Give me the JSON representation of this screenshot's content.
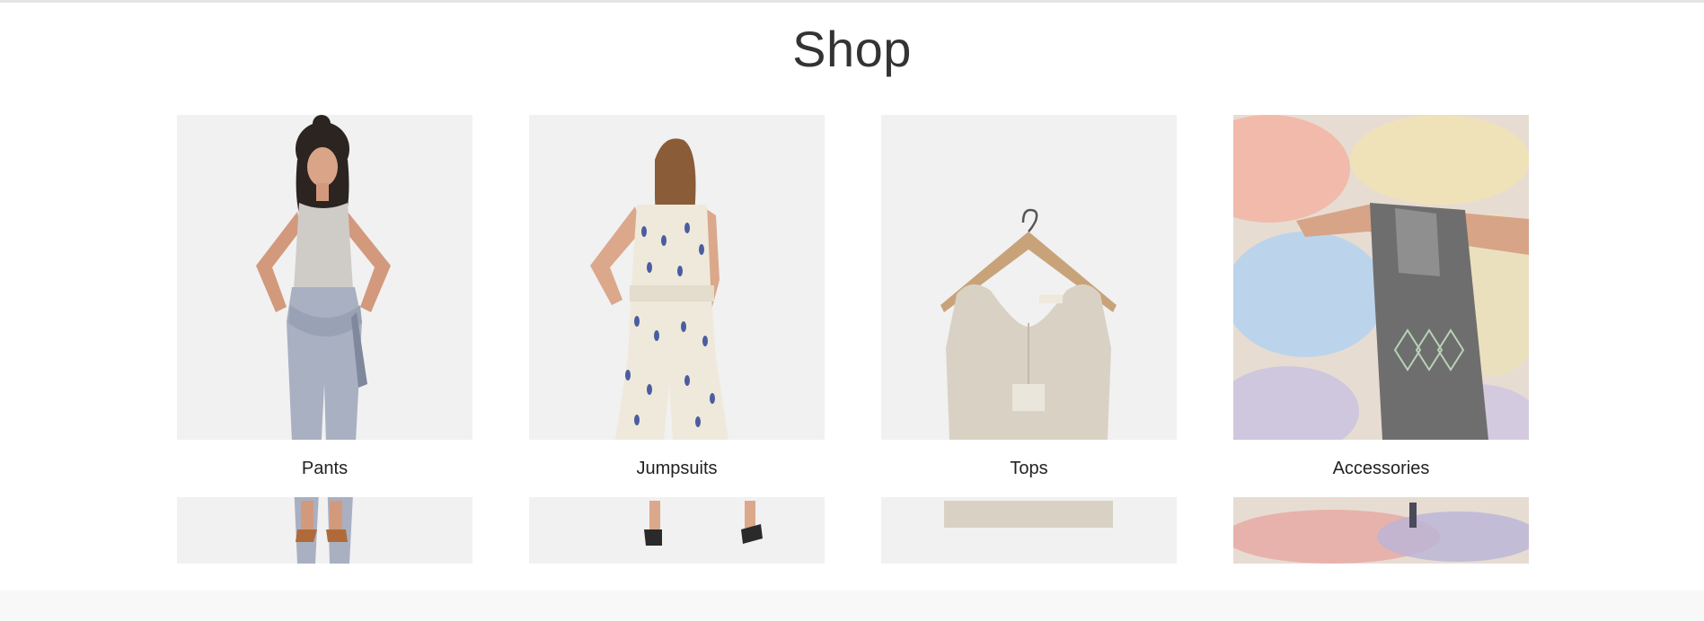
{
  "page": {
    "title": "Shop"
  },
  "categories": [
    {
      "label": "Pants"
    },
    {
      "label": "Jumpsuits"
    },
    {
      "label": "Tops"
    },
    {
      "label": "Accessories"
    }
  ]
}
